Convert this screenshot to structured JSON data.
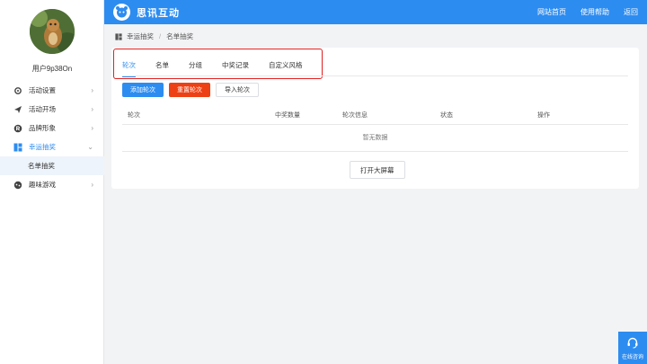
{
  "colors": {
    "primary": "#2d8cf0",
    "danger": "#ed4014",
    "highlight": "#e02020"
  },
  "header": {
    "brand": "思讯互动",
    "nav": [
      "网站首页",
      "使用帮助",
      "返回"
    ]
  },
  "sidebar": {
    "username": "用户9p38On",
    "items": [
      {
        "label": "活动设置",
        "icon": "gear-icon"
      },
      {
        "label": "活动开场",
        "icon": "send-icon"
      },
      {
        "label": "品牌形象",
        "icon": "brand-icon"
      },
      {
        "label": "幸运抽奖",
        "icon": "grid-icon",
        "active": true
      },
      {
        "label": "趣味游戏",
        "icon": "gamepad-icon"
      }
    ],
    "sub_items": [
      "名单抽奖"
    ]
  },
  "breadcrumb": [
    "幸运抽奖",
    "名单抽奖"
  ],
  "tabs": [
    "轮次",
    "名单",
    "分组",
    "中奖记录",
    "自定义风格"
  ],
  "actions": {
    "add": "添加轮次",
    "reset": "重置轮次",
    "import": "导入轮次"
  },
  "table": {
    "columns": [
      "轮次",
      "中奖数量",
      "轮次信息",
      "状态",
      "操作"
    ],
    "empty": "暂无数据"
  },
  "open_screen": "打开大屏幕",
  "help": "在线咨询"
}
